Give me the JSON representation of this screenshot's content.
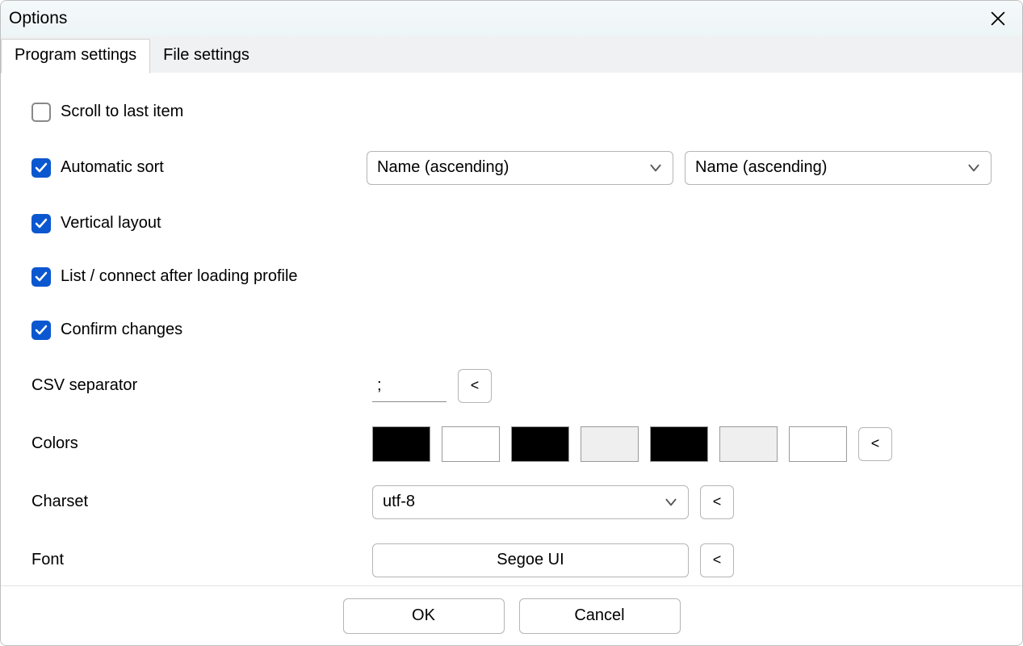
{
  "window": {
    "title": "Options"
  },
  "tabs": {
    "program": "Program settings",
    "file": "File settings"
  },
  "options": {
    "scroll_to_last": {
      "label": "Scroll to last item",
      "checked": false
    },
    "auto_sort": {
      "label": "Automatic sort",
      "checked": true
    },
    "vertical": {
      "label": "Vertical layout",
      "checked": true
    },
    "list_connect": {
      "label": "List / connect after loading profile",
      "checked": true
    },
    "confirm": {
      "label": "Confirm changes",
      "checked": true
    }
  },
  "sort": {
    "primary": "Name (ascending)",
    "secondary": "Name (ascending)"
  },
  "csv": {
    "label": "CSV separator",
    "value": ";",
    "reset": "<"
  },
  "colors": {
    "label": "Colors",
    "swatches": [
      "#000000",
      "#ffffff",
      "#000000",
      "#efefef",
      "#000000",
      "#efefef",
      "#ffffff"
    ],
    "reset": "<"
  },
  "charset": {
    "label": "Charset",
    "value": "utf-8",
    "reset": "<"
  },
  "font": {
    "label": "Font",
    "value": "Segoe UI",
    "reset": "<"
  },
  "buttons": {
    "ok": "OK",
    "cancel": "Cancel"
  }
}
